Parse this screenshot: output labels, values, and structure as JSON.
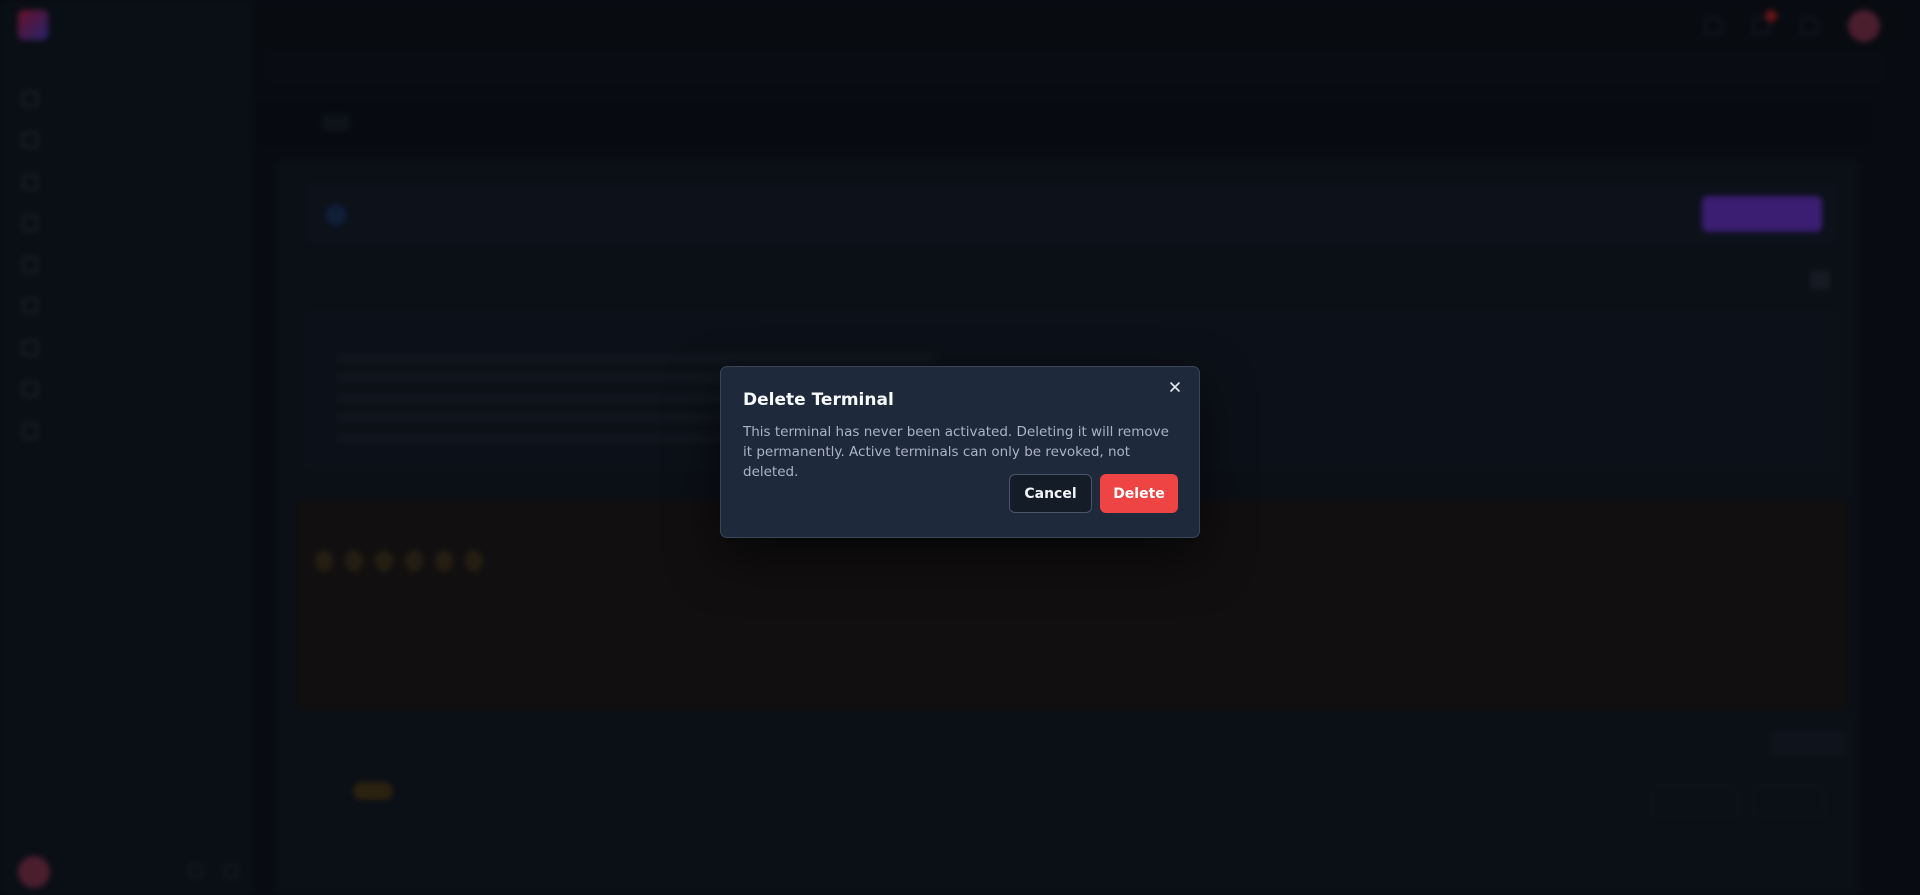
{
  "modal": {
    "title": "Delete Terminal",
    "body": "This terminal has never been activated. Deleting it will remove it permanently. Active terminals can only be revoked, not deleted.",
    "cancel_label": "Cancel",
    "delete_label": "Delete",
    "close_icon": "close-icon",
    "delete_color": "#ef4444"
  }
}
